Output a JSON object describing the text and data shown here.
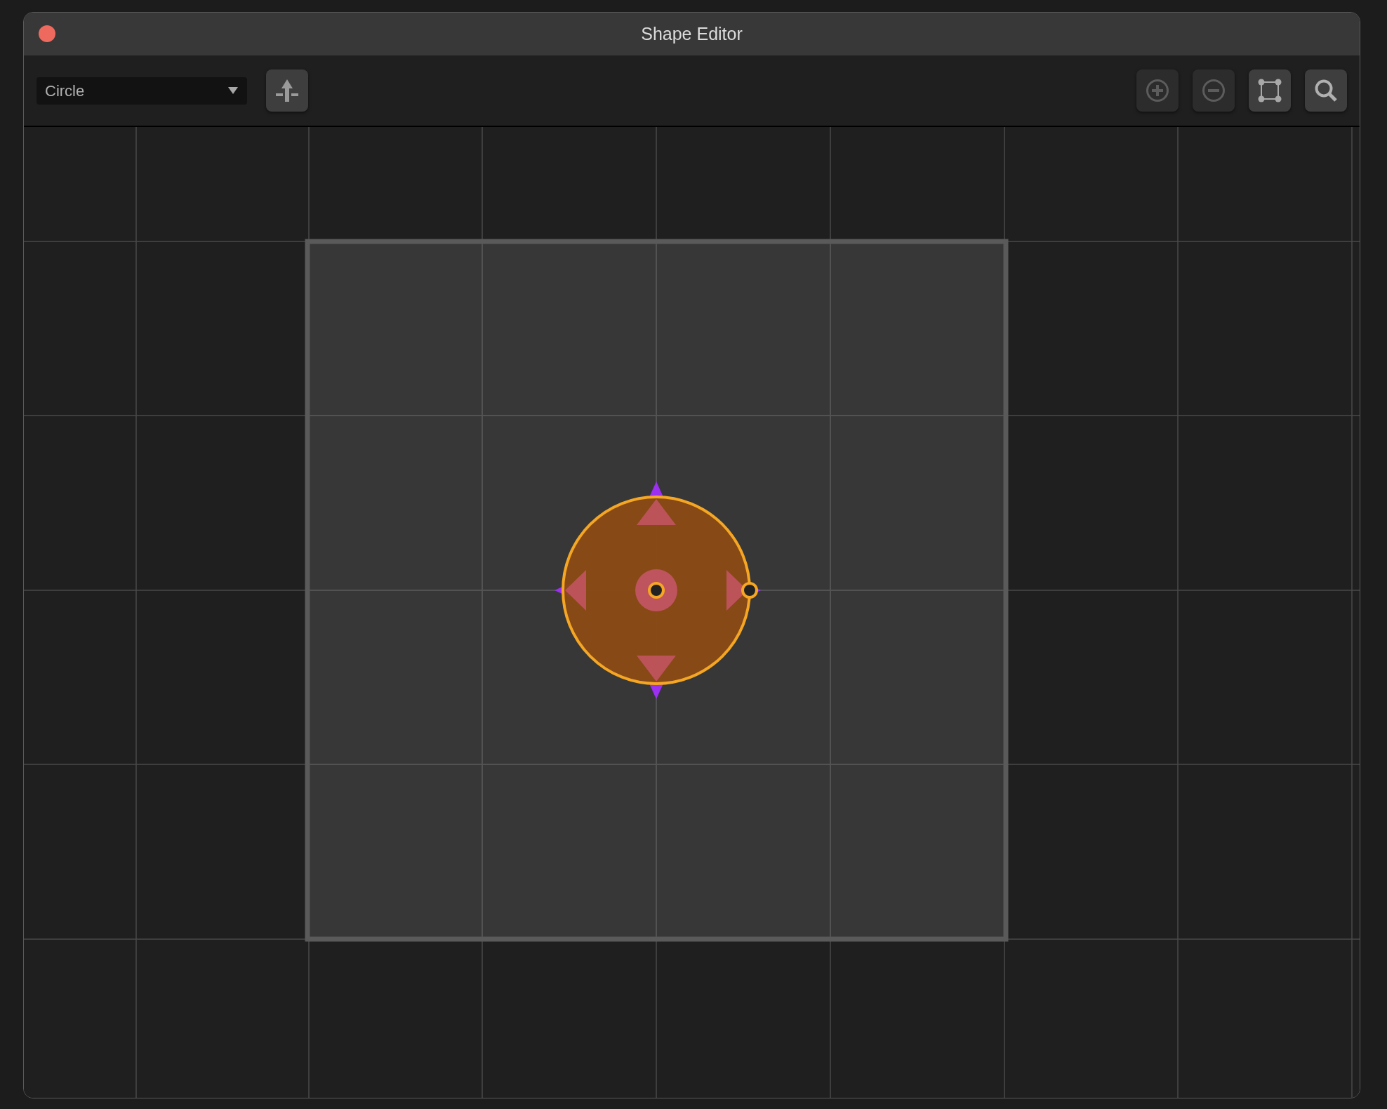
{
  "window": {
    "title": "Shape Editor"
  },
  "toolbar": {
    "shape_select": {
      "value": "Circle"
    }
  }
}
